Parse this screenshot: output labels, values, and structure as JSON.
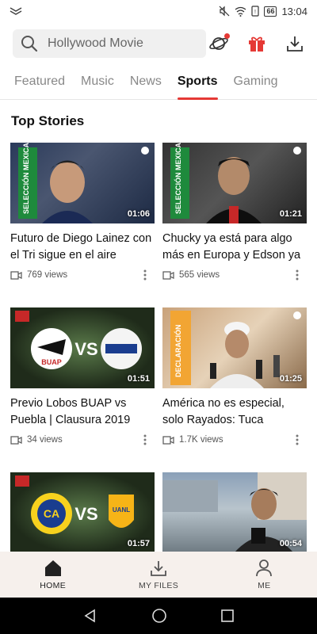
{
  "status": {
    "battery": "66",
    "time": "13:04"
  },
  "search": {
    "placeholder": "Hollywood Movie"
  },
  "tabs": [
    {
      "label": "Featured"
    },
    {
      "label": "Music"
    },
    {
      "label": "News"
    },
    {
      "label": "Sports",
      "active": true
    },
    {
      "label": "Gaming"
    }
  ],
  "section": {
    "title": "Top Stories"
  },
  "videos": [
    {
      "title": "Futuro de Diego Lainez con el Tri sigue en el aire",
      "views": "769 views",
      "duration": "01:06",
      "thumb_text": "SELECCIÓN MEXICANA"
    },
    {
      "title": "Chucky ya está para algo más en Europa y Edson ya",
      "views": "565 views",
      "duration": "01:21",
      "thumb_text": "SELECCIÓN MEXICANA"
    },
    {
      "title": "Previo Lobos BUAP vs Puebla | Clausura 2019",
      "views": "34 views",
      "duration": "01:51",
      "thumb_text": "VS"
    },
    {
      "title": "América no es especial, solo Rayados: Tuca",
      "views": "1.7K views",
      "duration": "01:25",
      "thumb_text": "DECLARACIÓN"
    },
    {
      "title": "",
      "views": "",
      "duration": "01:57",
      "thumb_text": "VS"
    },
    {
      "title": "",
      "views": "",
      "duration": "00:54",
      "thumb_text": ""
    }
  ],
  "bottom_nav": [
    {
      "label": "HOME",
      "icon": "home-icon"
    },
    {
      "label": "MY FILES",
      "icon": "download-icon"
    },
    {
      "label": "ME",
      "icon": "person-icon"
    }
  ],
  "colors": {
    "accent": "#e53935",
    "nav_bg": "#f6f0ec"
  }
}
